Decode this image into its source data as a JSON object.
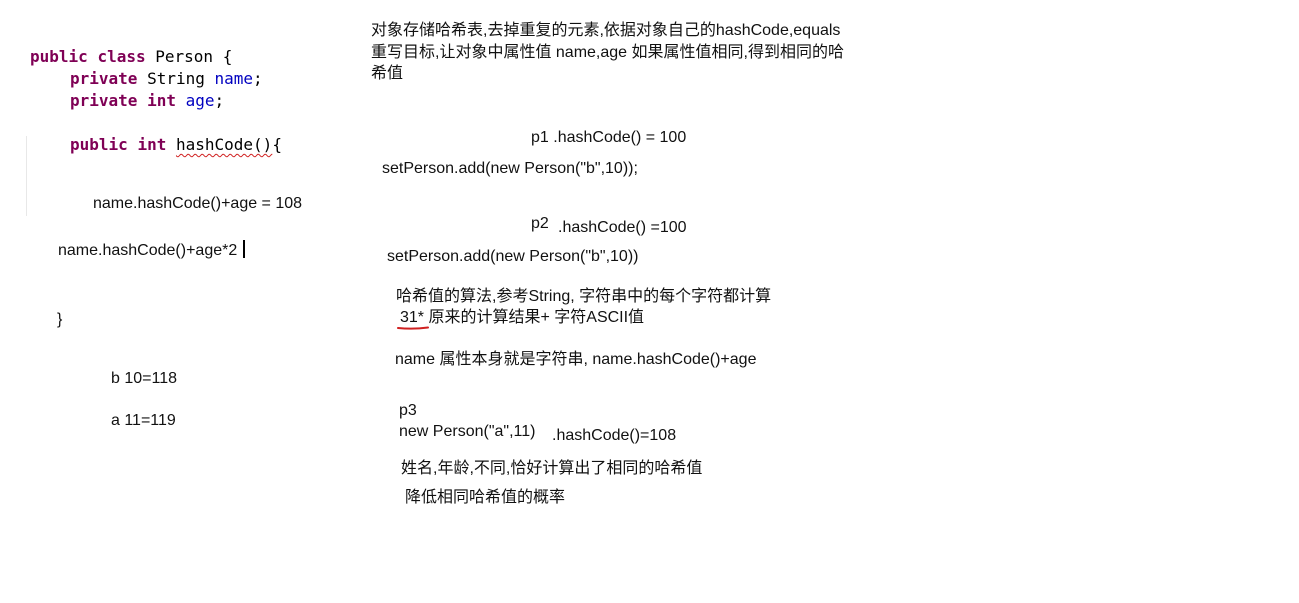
{
  "code": {
    "line1": {
      "kw1": "public",
      "kw2": "class",
      "name": "Person",
      "brace": "{"
    },
    "line2": {
      "kw": "private",
      "type": "String",
      "field": "name",
      "semi": ";"
    },
    "line3": {
      "kw": "private",
      "type": "int",
      "field": "age",
      "semi": ";"
    },
    "line4": {
      "kw1": "public",
      "kw2": "int",
      "method": "hashCode()",
      "brace": "{"
    },
    "calc1": "name.hashCode()+age = 108",
    "calc2": "name.hashCode()+age*2",
    "close_brace": "}",
    "example1": "b 10=118",
    "example2": "a 11=119"
  },
  "notes": {
    "intro_line1": "对象存储哈希表,去掉重复的元素,依据对象自己的hashCode,equals",
    "intro_line2": "重写目标,让对象中属性值 name,age 如果属性值相同,得到相同的哈",
    "intro_line3": "希值",
    "p1_hash": "p1 .hashCode() = 100",
    "p1_add": "setPerson.add(new Person(\"b\",10));",
    "p2_label": "p2",
    "p2_hash": ".hashCode() =100",
    "p2_add": "setPerson.add(new Person(\"b\",10))",
    "algo_line1": "哈希值的算法,参考String, 字符串中的每个字符都计算",
    "algo_line2_num": "31*",
    "algo_line2_rest": " 原来的计算结果+ 字符ASCII值",
    "name_note": "name 属性本身就是字符串, name.hashCode()+age",
    "p3_label": "p3",
    "p3_new": "new Person(\"a\",11)",
    "p3_hash": ".hashCode()=108",
    "collision_note": "姓名,年龄,不同,恰好计算出了相同的哈希值",
    "reduce_note": "降低相同哈希值的概率"
  },
  "colors": {
    "keyword": "#7f0055",
    "field": "#0000c0",
    "underline_red": "#d02020"
  }
}
